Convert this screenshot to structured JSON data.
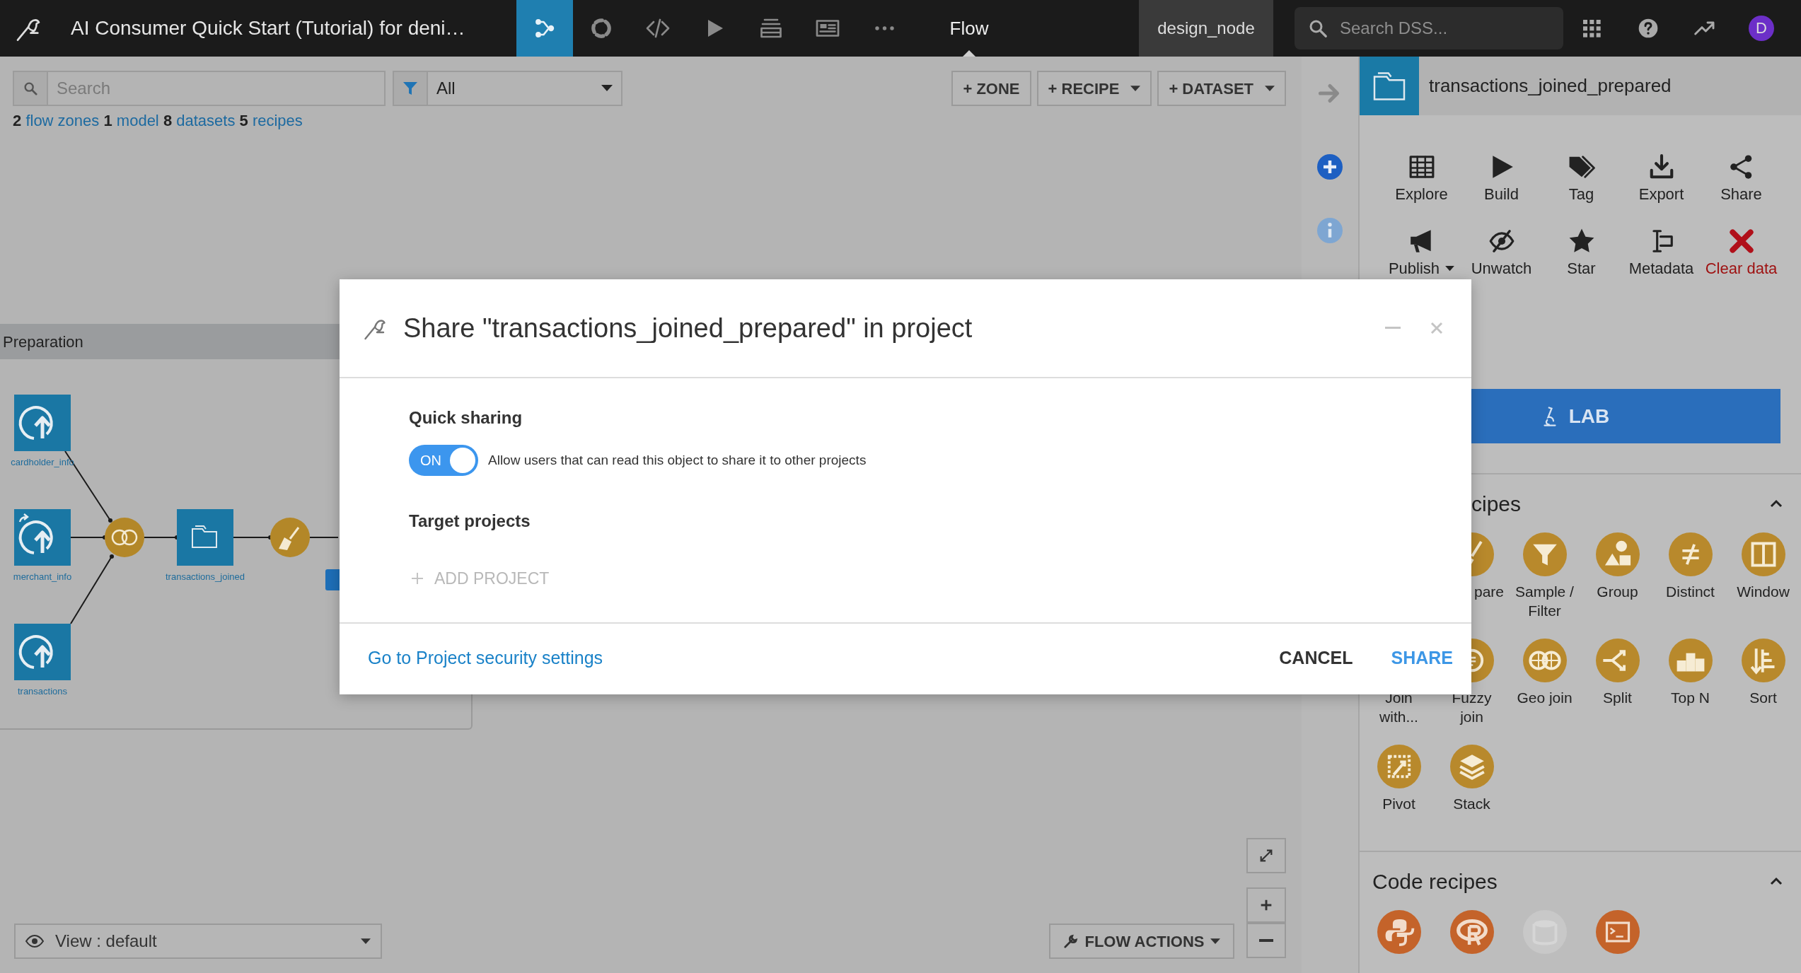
{
  "topbar": {
    "project_title": "AI Consumer Quick Start (Tutorial) for deni…",
    "nav_icons": [
      {
        "kind": "flow",
        "selected": true
      },
      {
        "kind": "ring",
        "selected": false
      },
      {
        "kind": "code",
        "selected": false
      },
      {
        "kind": "run",
        "selected": false
      },
      {
        "kind": "stack",
        "selected": false
      },
      {
        "kind": "dashboard",
        "selected": false
      },
      {
        "kind": "more",
        "selected": false
      }
    ],
    "section_label": "Flow",
    "node_name": "design_node",
    "search_placeholder": "Search DSS...",
    "avatar": "D"
  },
  "toolbar": {
    "search_placeholder": "Search",
    "filter_value": "All",
    "buttons": [
      {
        "label": "+ ZONE",
        "caret": false
      },
      {
        "label": "+ RECIPE",
        "caret": true
      },
      {
        "label": "+ DATASET",
        "caret": true
      }
    ]
  },
  "summary": [
    {
      "count": "2",
      "label": "flow zones"
    },
    {
      "count": "1",
      "label": "model"
    },
    {
      "count": "8",
      "label": "datasets"
    },
    {
      "count": "5",
      "label": "recipes"
    }
  ],
  "zone": {
    "title": "Preparation",
    "nodes": [
      {
        "kind": "upload",
        "label": "cardholder_info",
        "shared": false
      },
      {
        "kind": "upload",
        "label": "merchant_info",
        "shared": true
      },
      {
        "kind": "upload",
        "label": "transactions",
        "shared": false
      },
      {
        "kind": "join"
      },
      {
        "kind": "dataset",
        "label": "transactions_joined",
        "shared": false
      },
      {
        "kind": "prepare"
      },
      {
        "kind": "dataset_tab"
      }
    ]
  },
  "bottom": {
    "view_label": "View : default",
    "flow_actions": "FLOW ACTIONS"
  },
  "panel": {
    "title": "transactions_joined_prepared",
    "actions": [
      {
        "kind": "explore",
        "label": "Explore",
        "caret": false,
        "danger": false
      },
      {
        "kind": "build",
        "label": "Build",
        "caret": false,
        "danger": false
      },
      {
        "kind": "tag",
        "label": "Tag",
        "caret": false,
        "danger": false
      },
      {
        "kind": "export",
        "label": "Export",
        "caret": false,
        "danger": false
      },
      {
        "kind": "share",
        "label": "Share",
        "caret": false,
        "danger": false
      },
      {
        "kind": "publish",
        "label": "Publish",
        "caret": true,
        "danger": false
      },
      {
        "kind": "unwatch",
        "label": "Unwatch",
        "caret": false,
        "danger": false
      },
      {
        "kind": "star",
        "label": "Star",
        "caret": false,
        "danger": false
      },
      {
        "kind": "metadata",
        "label": "Metadata",
        "caret": false,
        "danger": false
      },
      {
        "kind": "clear",
        "label": "Clear data",
        "caret": false,
        "danger": true
      }
    ],
    "lab_button": "LAB",
    "visual_recipes": {
      "title": "cipes",
      "expanded": true,
      "items": [
        {
          "kind": "prepare",
          "label": "pare"
        },
        {
          "kind": "sample",
          "label": "Sample / Filter"
        },
        {
          "kind": "group",
          "label": "Group"
        },
        {
          "kind": "distinct",
          "label": "Distinct"
        },
        {
          "kind": "window",
          "label": "Window"
        },
        {
          "kind": "covered",
          "label": "Join with..."
        },
        {
          "kind": "fuzzy",
          "label": "Fuzzy join"
        },
        {
          "kind": "geo",
          "label": "Geo join"
        },
        {
          "kind": "split",
          "label": "Split"
        },
        {
          "kind": "topn",
          "label": "Top N"
        },
        {
          "kind": "sort",
          "label": "Sort"
        },
        {
          "kind": "pivot",
          "label": "Pivot"
        },
        {
          "kind": "stack",
          "label": "Stack"
        }
      ]
    },
    "code_recipes": {
      "title": "Code recipes",
      "expanded": true,
      "items": [
        {
          "kind": "python",
          "disabled": false
        },
        {
          "kind": "r",
          "disabled": false
        },
        {
          "kind": "sql",
          "disabled": true
        },
        {
          "kind": "shell",
          "disabled": false
        }
      ]
    }
  },
  "dialog": {
    "title": "Share \"transactions_joined_prepared\" in project",
    "quick_sharing_heading": "Quick sharing",
    "toggle": {
      "on": true,
      "label": "ON"
    },
    "toggle_description": "Allow users that can read this object to share it to other projects",
    "target_heading": "Target projects",
    "add_project": "ADD PROJECT",
    "footer_link": "Go to Project security settings",
    "buttons": [
      {
        "label": "CANCEL",
        "kind": "secondary"
      },
      {
        "label": "SHARE",
        "kind": "primary"
      }
    ]
  }
}
